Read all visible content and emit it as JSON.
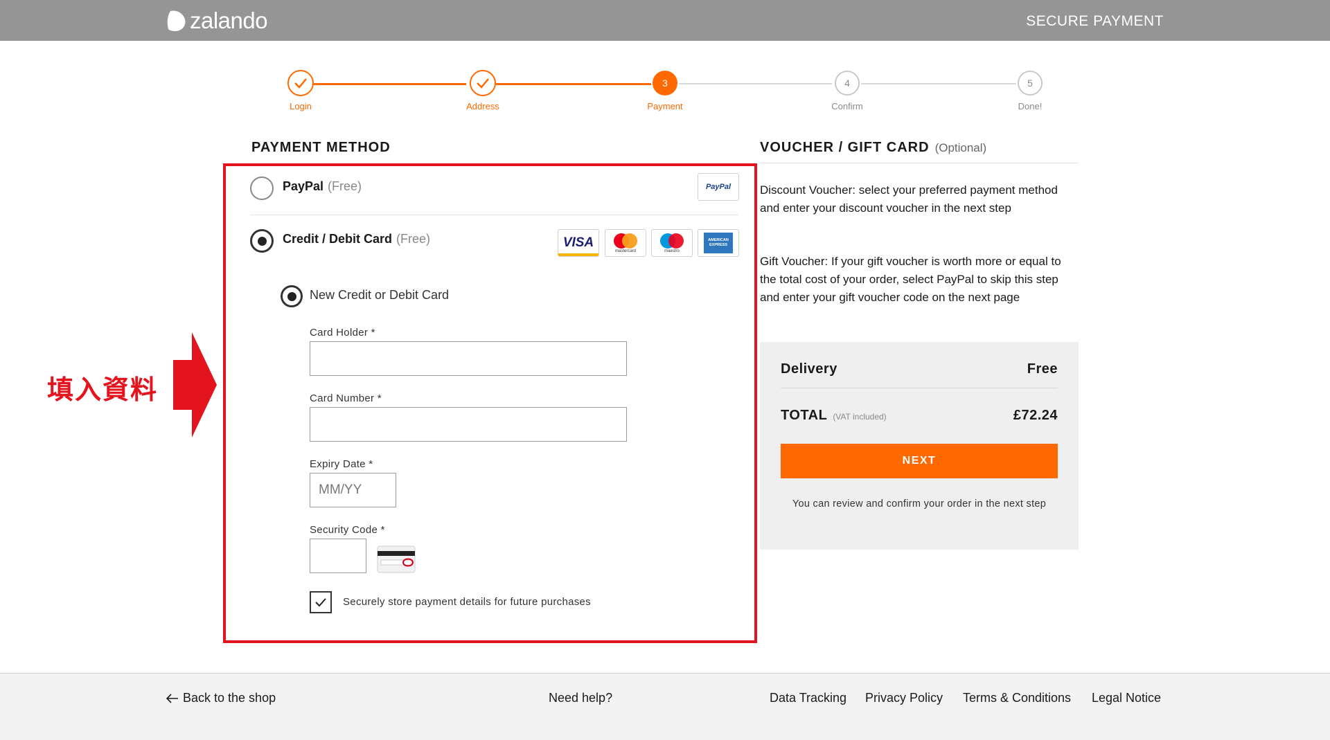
{
  "header": {
    "logo_text": "zalando",
    "secure_label": "SECURE PAYMENT"
  },
  "stepper": {
    "steps": [
      {
        "label": "Login",
        "number": "1",
        "state": "done"
      },
      {
        "label": "Address",
        "number": "2",
        "state": "done"
      },
      {
        "label": "Payment",
        "number": "3",
        "state": "current"
      },
      {
        "label": "Confirm",
        "number": "4",
        "state": "todo"
      },
      {
        "label": "Done!",
        "number": "5",
        "state": "todo"
      }
    ]
  },
  "payment": {
    "title": "PAYMENT METHOD",
    "options": [
      {
        "label": "PayPal",
        "fee": "(Free)",
        "selected": false,
        "logo_text": "PayPal"
      },
      {
        "label": "Credit / Debit Card",
        "fee": "(Free)",
        "selected": true
      }
    ],
    "card_logos": [
      {
        "name": "visa-logo",
        "text": "VISA"
      },
      {
        "name": "mastercard-logo",
        "text": "mastercard"
      },
      {
        "name": "maestro-logo",
        "text": "maestro"
      },
      {
        "name": "amex-logo",
        "text": "AMERICAN EXPRESS"
      }
    ],
    "new_card": {
      "label": "New Credit or Debit Card",
      "selected": true
    },
    "fields": {
      "card_holder": {
        "label": "Card Holder *",
        "value": "",
        "placeholder": ""
      },
      "card_number": {
        "label": "Card Number *",
        "value": "",
        "placeholder": ""
      },
      "expiry": {
        "label": "Expiry Date *",
        "value": "",
        "placeholder": "MM/YY"
      },
      "security_code": {
        "label": "Security Code *",
        "value": "",
        "placeholder": ""
      }
    },
    "store_details": {
      "label": "Securely store payment details for future purchases",
      "checked": true
    }
  },
  "annotation": {
    "text": "填入資料",
    "color": "#e3141e"
  },
  "voucher": {
    "title": "VOUCHER / GIFT CARD",
    "optional": "(Optional)",
    "discount_text": "Discount Voucher: select your preferred payment method and enter your discount voucher in the next step",
    "gift_text": "Gift Voucher: If your gift voucher is worth more or equal to the total cost of your order, select PayPal to skip this step and enter your gift voucher code on the next page"
  },
  "summary": {
    "delivery_label": "Delivery",
    "delivery_value": "Free",
    "total_label": "TOTAL",
    "vat_note": "(VAT included)",
    "total_value": "£72.24",
    "next_label": "NEXT",
    "review_note": "You can review and confirm your order in the next step"
  },
  "footer": {
    "back_label": "Back to the shop",
    "help_label": "Need help?",
    "links": [
      "Data Tracking",
      "Privacy Policy",
      "Terms & Conditions",
      "Legal Notice"
    ]
  },
  "colors": {
    "accent": "#ff6900",
    "header_bg": "#959595",
    "annotation_red": "#e3141e"
  }
}
